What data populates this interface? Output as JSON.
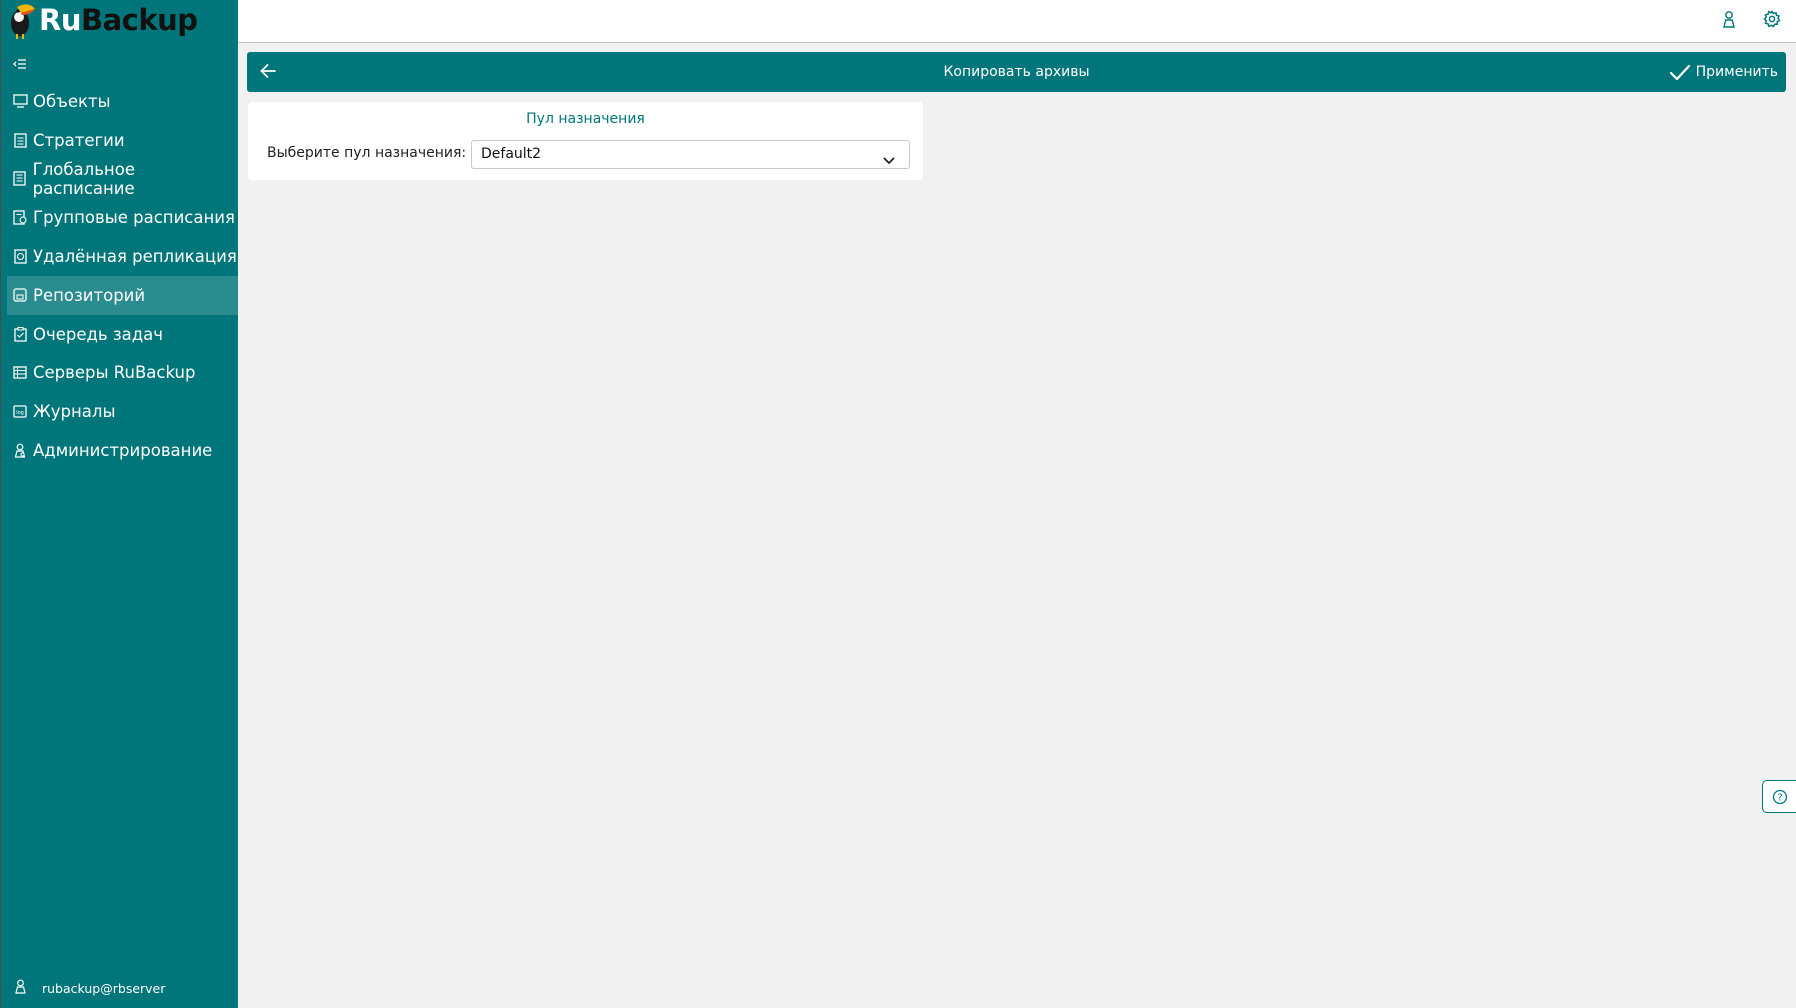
{
  "app": {
    "logo_ru": "Ru",
    "logo_backup": "Backup"
  },
  "sidebar": {
    "items": [
      {
        "label": "Объекты",
        "icon": "monitor-icon"
      },
      {
        "label": "Стратегии",
        "icon": "document-icon"
      },
      {
        "label": "Глобальное расписание",
        "icon": "document-list-icon"
      },
      {
        "label": "Групповые расписания",
        "icon": "group-schedule-icon"
      },
      {
        "label": "Удалённая репликация",
        "icon": "replication-icon"
      },
      {
        "label": "Репозиторий",
        "icon": "repository-icon",
        "active": true
      },
      {
        "label": "Очередь задач",
        "icon": "task-queue-icon"
      },
      {
        "label": "Серверы RuBackup",
        "icon": "server-icon"
      },
      {
        "label": "Журналы",
        "icon": "log-icon"
      },
      {
        "label": "Администрирование",
        "icon": "admin-user-icon"
      }
    ],
    "user": "rubackup@rbserver"
  },
  "header": {
    "title": "Копировать архивы",
    "apply_label": "Применить"
  },
  "panel": {
    "title": "Пул назначения",
    "select_label": "Выберите пул назначения:",
    "select_value": "Default2"
  },
  "colors": {
    "accent": "#00767a",
    "active_item": "#2b8c8f",
    "background": "#f1f1f1"
  }
}
